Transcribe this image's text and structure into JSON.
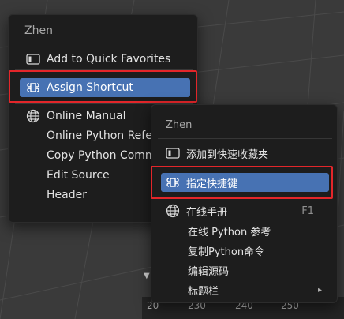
{
  "menu_en": {
    "title": "Zhen",
    "items": [
      {
        "label": "Add to Quick Favorites",
        "icon": "favorites-icon"
      },
      {
        "label": "Assign Shortcut",
        "icon": "shortcut-icon",
        "highlighted": true
      },
      {
        "label": "Online Manual",
        "icon": "globe-icon"
      },
      {
        "label": "Online Python Refer"
      },
      {
        "label": "Copy Python Comm"
      },
      {
        "label": "Edit Source"
      },
      {
        "label": "Header"
      }
    ]
  },
  "menu_zh": {
    "title": "Zhen",
    "items": [
      {
        "label": "添加到快速收藏夹",
        "icon": "favorites-icon"
      },
      {
        "label": "指定快捷键",
        "icon": "shortcut-icon",
        "highlighted": true
      },
      {
        "label": "在线手册",
        "icon": "globe-icon",
        "shortcut": "F1"
      },
      {
        "label": "在线 Python 参考"
      },
      {
        "label": "复制Python命令"
      },
      {
        "label": "编辑源码"
      },
      {
        "label": "标题栏",
        "submenu": "▸"
      }
    ]
  },
  "ruler": [
    "20",
    "230",
    "240",
    "250"
  ],
  "colors": {
    "highlight": "#4772b3",
    "menu_bg": "#1d1d1d",
    "annotation_red": "#e3262a"
  }
}
